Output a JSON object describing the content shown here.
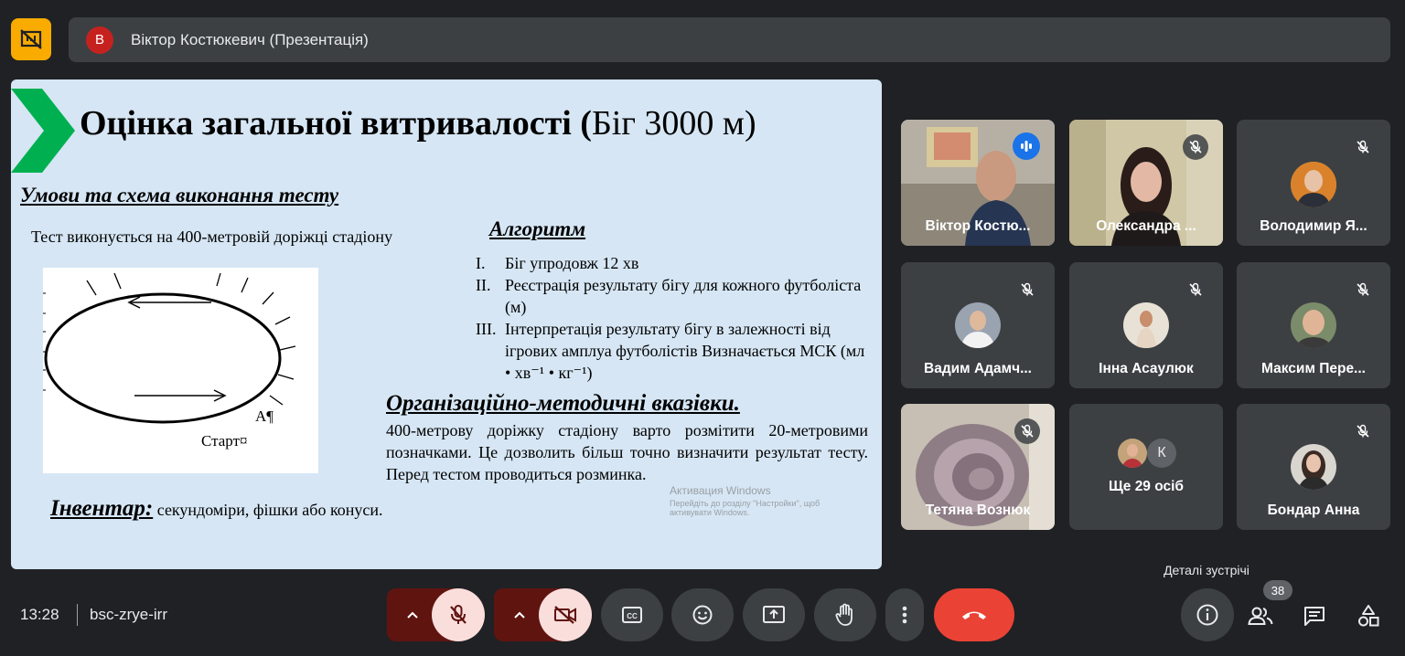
{
  "presenter": {
    "avatar_letter": "В",
    "label": "Віктор Костюкевич (Презентація)"
  },
  "slide": {
    "title_bold": "Оцінка загальної витривалості (",
    "title_normal": "Біг 3000 м)",
    "subheading": "Умови та схема виконання тесту",
    "track_note": "Тест виконується на 400-метровій доріжці стадіону",
    "algorithm_heading": "Алгоритм",
    "algorithm": [
      {
        "num": "I.",
        "text": "Біг упродовж 12 хв"
      },
      {
        "num": "II.",
        "text": "Реєстрація результату бігу для кожного футболіста (м)"
      },
      {
        "num": "III.",
        "text": "Інтерпретація результату бігу в залежності від ігрових амплуа футболістів Визначається МСК (мл • хв⁻¹ • кг⁻¹)"
      }
    ],
    "org_heading": "Організаційно-методичні вказівки.",
    "org_text": "400-метрову доріжку стадіону варто розмітити 20-метровими позначками. Це дозволить більш точно визначити результат тесту. Перед тестом проводиться розминка.",
    "inventory_label": "Інвентар:",
    "inventory_text": " секундоміри, фішки або конуси.",
    "diagram_point_a": "А¶",
    "diagram_start": "Старт¤",
    "watermark_title": "Активация Windows",
    "watermark_line1": "Перейдіть до розділу \"Настройки\", щоб",
    "watermark_line2": "активувати Windows."
  },
  "participants": [
    {
      "name": "Віктор Костю...",
      "status": "speaking"
    },
    {
      "name": "Олександра ...",
      "status": "muted"
    },
    {
      "name": "Володимир Я...",
      "status": "muted"
    },
    {
      "name": "Вадим Адамч...",
      "status": "muted"
    },
    {
      "name": "Інна Асаулюк",
      "status": "muted"
    },
    {
      "name": "Максим Пере...",
      "status": "muted"
    },
    {
      "name": "Тетяна Вознюк",
      "status": "muted"
    },
    {
      "name": "Ще 29 осіб",
      "avatar_letter": "К"
    },
    {
      "name": "Бондар Анна",
      "status": "muted"
    }
  ],
  "bottom": {
    "time": "13:28",
    "meeting_code": "bsc-zrye-irr",
    "tooltip": "Деталі зустрічі",
    "people_count": "38"
  },
  "colors": {
    "accent": "#8ab4f8",
    "end_call": "#ea4335",
    "muted_bg": "#f9dedc",
    "caret_bg": "#601410",
    "present": "#f9ab00"
  }
}
